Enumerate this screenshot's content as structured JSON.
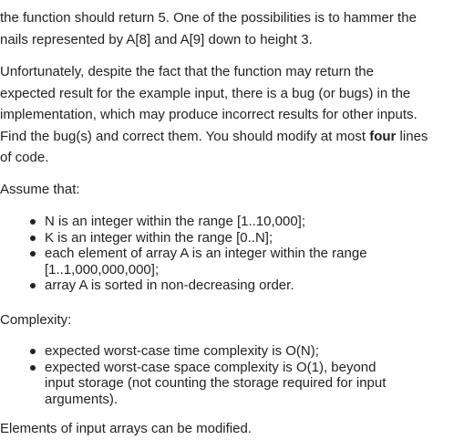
{
  "para1": {
    "lines": [
      "the function should return 5. One of the possibilities is to hammer the",
      "nails represented by A[8] and A[9] down to height 3."
    ]
  },
  "para2": {
    "lines": [
      "Unfortunately, despite the fact that the function may return the",
      "expected result for the example input, there is a bug (or bugs) in the",
      "implementation, which may produce incorrect results for other inputs."
    ],
    "line4_before": "Find the bug(s) and correct them. You should modify at most ",
    "line4_bold": "four",
    "line4_after": " lines",
    "line5": "of code."
  },
  "assume_heading": "Assume that:",
  "assume_items": [
    [
      "N is an integer within the range [1..10,000];"
    ],
    [
      "K is an integer within the range [0..N];"
    ],
    [
      "each element of array A is an integer within the range",
      "[1..1,000,000,000];"
    ],
    [
      "array A is sorted in non-decreasing order."
    ]
  ],
  "complexity_heading": "Complexity:",
  "complexity_items": [
    [
      "expected worst-case time complexity is O(N);"
    ],
    [
      "expected worst-case space complexity is O(1), beyond",
      "input storage (not counting the storage required for input",
      "arguments)."
    ]
  ],
  "footer": "Elements of input arrays can be modified."
}
